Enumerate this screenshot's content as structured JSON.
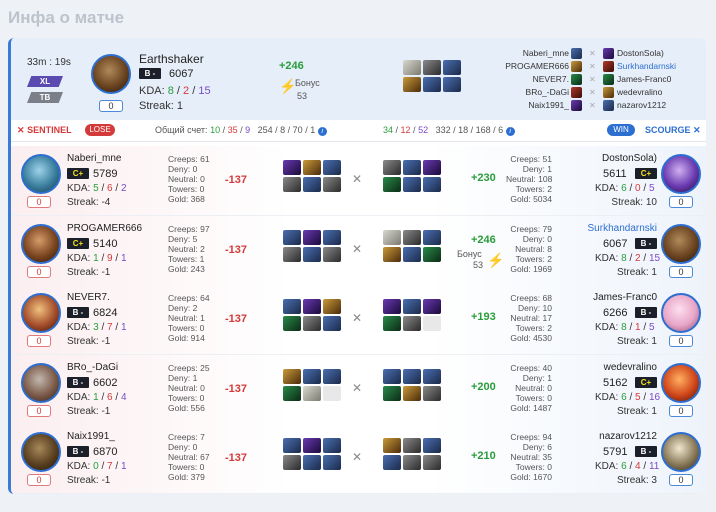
{
  "page_title": "Инфа о матче",
  "header": {
    "duration": "33m : 19s",
    "tags": [
      "XL",
      "TB"
    ],
    "player": {
      "name": "Earthshaker",
      "rank": "B -",
      "mmr": "6067",
      "kda": [
        "8",
        "2",
        "15"
      ],
      "kda_label": "KDA:",
      "streak": "Streak: 1",
      "badge": "0"
    },
    "delta": "+246",
    "bonus_label": "Бонус",
    "bonus_value": "53",
    "mini_left": [
      "Naberi_mne",
      "PROGAMER666",
      "NEVER7.",
      "BRo_-DaGi",
      "Naix1991_"
    ],
    "mini_right": [
      "DostonSola)",
      "Surkhandarnski",
      "James-Franc0",
      "wedevralino",
      "nazarov1212"
    ]
  },
  "bar": {
    "sentinel": "SENTINEL",
    "lose": "LOSE",
    "score_label": "Общий счет:",
    "score_a": [
      "10",
      "35",
      "9"
    ],
    "nw_a": "254 / 8 / 70 / 1",
    "score_b": [
      "34",
      "12",
      "52"
    ],
    "nw_b": "332 / 18 / 168 / 6",
    "win": "WIN",
    "scourge": "SCOURGE"
  },
  "rows": [
    {
      "left": {
        "name": "Naberi_mne",
        "rank": "C+",
        "mmr": "5789",
        "kda": [
          "5",
          "6",
          "2"
        ],
        "streak": "Streak: -4",
        "badge": "0",
        "stats": [
          "Creeps: 61",
          "Deny: 0",
          "Neutral: 0",
          "Towers: 0",
          "Gold: 368"
        ],
        "delta": "-137"
      },
      "right": {
        "name": "DostonSola)",
        "rank": "C+",
        "mmr": "5611",
        "kda": [
          "6",
          "0",
          "5"
        ],
        "streak": "Streak: 10",
        "badge": "0",
        "stats": [
          "Creeps: 51",
          "Deny: 1",
          "Neutral: 108",
          "Towers: 2",
          "Gold: 5034"
        ],
        "delta": "+230"
      }
    },
    {
      "left": {
        "name": "PROGAMER666",
        "rank": "C+",
        "mmr": "5140",
        "kda": [
          "1",
          "9",
          "1"
        ],
        "streak": "Streak: -1",
        "badge": "0",
        "stats": [
          "Creeps: 97",
          "Deny: 5",
          "Neutral: 2",
          "Towers: 1",
          "Gold: 243"
        ],
        "delta": "-137"
      },
      "right": {
        "name": "Surkhandarnski",
        "rank": "B -",
        "mmr": "6067",
        "kda": [
          "8",
          "2",
          "15"
        ],
        "streak": "Streak: 1",
        "badge": "0",
        "stats": [
          "Creeps: 79",
          "Deny: 0",
          "Neutral: 8",
          "Towers: 2",
          "Gold: 1969"
        ],
        "delta": "+246",
        "bonus": "Бонус",
        "bonus_value": "53"
      }
    },
    {
      "left": {
        "name": "NEVER7.",
        "rank": "B -",
        "mmr": "6824",
        "kda": [
          "3",
          "7",
          "1"
        ],
        "streak": "Streak: -1",
        "badge": "0",
        "stats": [
          "Creeps: 64",
          "Deny: 2",
          "Neutral: 1",
          "Towers: 0",
          "Gold: 914"
        ],
        "delta": "-137"
      },
      "right": {
        "name": "James-Franc0",
        "rank": "B -",
        "mmr": "6266",
        "kda": [
          "8",
          "1",
          "5"
        ],
        "streak": "Streak: 1",
        "badge": "0",
        "stats": [
          "Creeps: 68",
          "Deny: 10",
          "Neutral: 17",
          "Towers: 2",
          "Gold: 4530"
        ],
        "delta": "+193"
      }
    },
    {
      "left": {
        "name": "BRo_-DaGi",
        "rank": "B -",
        "mmr": "6602",
        "kda": [
          "1",
          "6",
          "4"
        ],
        "streak": "Streak: -1",
        "badge": "0",
        "stats": [
          "Creeps: 25",
          "Deny: 1",
          "Neutral: 0",
          "Towers: 0",
          "Gold: 556"
        ],
        "delta": "-137"
      },
      "right": {
        "name": "wedevralino",
        "rank": "C+",
        "mmr": "5162",
        "kda": [
          "6",
          "5",
          "16"
        ],
        "streak": "Streak: 1",
        "badge": "0",
        "stats": [
          "Creeps: 40",
          "Deny: 1",
          "Neutral: 0",
          "Towers: 0",
          "Gold: 1487"
        ],
        "delta": "+200"
      }
    },
    {
      "left": {
        "name": "Naix1991_",
        "rank": "B -",
        "mmr": "6870",
        "kda": [
          "0",
          "7",
          "1"
        ],
        "streak": "Streak: -1",
        "badge": "0",
        "stats": [
          "Creeps: 7",
          "Deny: 0",
          "Neutral: 67",
          "Towers: 0",
          "Gold: 379"
        ],
        "delta": "-137"
      },
      "right": {
        "name": "nazarov1212",
        "rank": "B -",
        "mmr": "5791",
        "kda": [
          "6",
          "4",
          "11"
        ],
        "streak": "Streak: 3",
        "badge": "0",
        "stats": [
          "Creeps: 94",
          "Deny: 6",
          "Neutral: 35",
          "Towers: 0",
          "Gold: 1670"
        ],
        "delta": "+210"
      }
    }
  ],
  "colors": {
    "accent": "#2c6fd1",
    "lose": "#d43a3a",
    "win_delta": "#2a9d3b",
    "kda_kill": "#2a9d3b",
    "kda_death": "#d43a3a",
    "kda_assist": "#7a4ac8"
  },
  "icons": [
    "swords-icon",
    "bolt-icon",
    "info-icon",
    "cross-icon"
  ]
}
